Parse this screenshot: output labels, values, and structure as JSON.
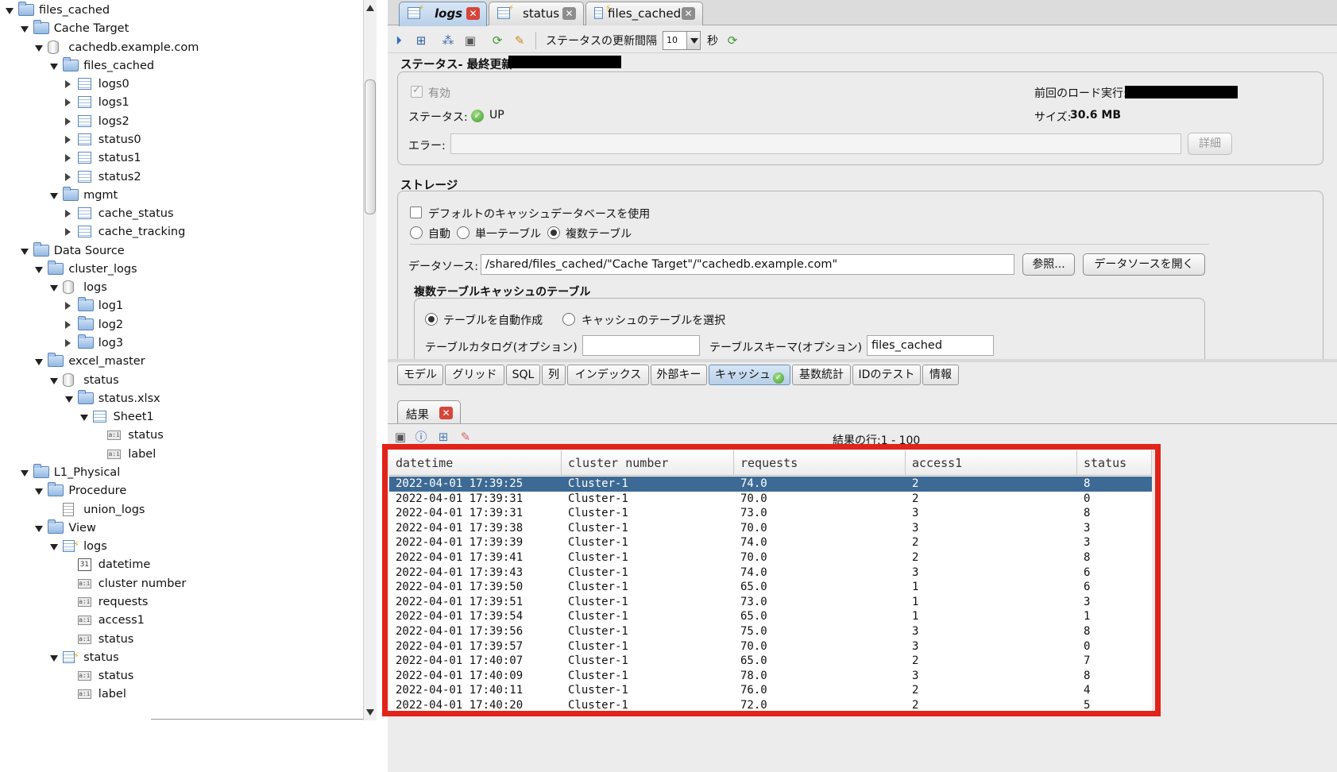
{
  "tree": {
    "nodes": [
      {
        "label": "files_cached",
        "depth": 0,
        "icon": "folder",
        "twisty": "open"
      },
      {
        "label": "Cache Target",
        "depth": 1,
        "icon": "folder",
        "twisty": "open"
      },
      {
        "label": "cachedb.example.com",
        "depth": 2,
        "icon": "database",
        "twisty": "open"
      },
      {
        "label": "files_cached",
        "depth": 3,
        "icon": "folder",
        "twisty": "open"
      },
      {
        "label": "logs0",
        "depth": 4,
        "icon": "table",
        "twisty": "closed"
      },
      {
        "label": "logs1",
        "depth": 4,
        "icon": "table",
        "twisty": "closed"
      },
      {
        "label": "logs2",
        "depth": 4,
        "icon": "table",
        "twisty": "closed"
      },
      {
        "label": "status0",
        "depth": 4,
        "icon": "table",
        "twisty": "closed"
      },
      {
        "label": "status1",
        "depth": 4,
        "icon": "table",
        "twisty": "closed"
      },
      {
        "label": "status2",
        "depth": 4,
        "icon": "table",
        "twisty": "closed"
      },
      {
        "label": "mgmt",
        "depth": 3,
        "icon": "folder",
        "twisty": "open"
      },
      {
        "label": "cache_status",
        "depth": 4,
        "icon": "table",
        "twisty": "closed"
      },
      {
        "label": "cache_tracking",
        "depth": 4,
        "icon": "table",
        "twisty": "closed"
      },
      {
        "label": "Data Source",
        "depth": 1,
        "icon": "folder",
        "twisty": "open"
      },
      {
        "label": "cluster_logs",
        "depth": 2,
        "icon": "folder",
        "twisty": "open"
      },
      {
        "label": "logs",
        "depth": 3,
        "icon": "database",
        "twisty": "open"
      },
      {
        "label": "log1",
        "depth": 4,
        "icon": "folder",
        "twisty": "closed"
      },
      {
        "label": "log2",
        "depth": 4,
        "icon": "folder",
        "twisty": "closed"
      },
      {
        "label": "log3",
        "depth": 4,
        "icon": "folder",
        "twisty": "closed"
      },
      {
        "label": "excel_master",
        "depth": 2,
        "icon": "folder",
        "twisty": "open"
      },
      {
        "label": "status",
        "depth": 3,
        "icon": "database",
        "twisty": "open"
      },
      {
        "label": "status.xlsx",
        "depth": 4,
        "icon": "folder",
        "twisty": "open"
      },
      {
        "label": "Sheet1",
        "depth": 5,
        "icon": "table",
        "twisty": "open"
      },
      {
        "label": "status",
        "depth": 6,
        "icon": "column",
        "twisty": "none"
      },
      {
        "label": "label",
        "depth": 6,
        "icon": "column",
        "twisty": "none"
      },
      {
        "label": "L1_Physical",
        "depth": 1,
        "icon": "folder",
        "twisty": "open"
      },
      {
        "label": "Procedure",
        "depth": 2,
        "icon": "folder",
        "twisty": "open"
      },
      {
        "label": "union_logs",
        "depth": 3,
        "icon": "document",
        "twisty": "none"
      },
      {
        "label": "View",
        "depth": 2,
        "icon": "folder",
        "twisty": "open"
      },
      {
        "label": "logs",
        "depth": 3,
        "icon": "view",
        "twisty": "open"
      },
      {
        "label": "datetime",
        "depth": 4,
        "icon": "date",
        "twisty": "none"
      },
      {
        "label": "cluster number",
        "depth": 4,
        "icon": "column",
        "twisty": "none"
      },
      {
        "label": "requests",
        "depth": 4,
        "icon": "column",
        "twisty": "none"
      },
      {
        "label": "access1",
        "depth": 4,
        "icon": "column",
        "twisty": "none"
      },
      {
        "label": "status",
        "depth": 4,
        "icon": "column",
        "twisty": "none"
      },
      {
        "label": "status",
        "depth": 3,
        "icon": "view",
        "twisty": "open"
      },
      {
        "label": "status",
        "depth": 4,
        "icon": "column",
        "twisty": "none"
      },
      {
        "label": "label",
        "depth": 4,
        "icon": "column",
        "twisty": "none"
      }
    ]
  },
  "tabs": [
    {
      "label": "logs",
      "active": true
    },
    {
      "label": "status",
      "active": false
    },
    {
      "label": "files_cached",
      "active": false
    }
  ],
  "toolbar": {
    "interval_label": "ステータスの更新間隔",
    "interval_value": "10",
    "interval_unit": "秒"
  },
  "status_section": {
    "title": "ステータス- 最終更新:",
    "enabled_label": "有効",
    "last_load_label": "前回のロード実行:",
    "status_label": "ステータス:",
    "status_value": "UP",
    "size_label": "サイズ:",
    "size_value": "30.6 MB",
    "error_label": "エラー:",
    "error_value": "",
    "detail_button": "詳細"
  },
  "storage_section": {
    "title": "ストレージ",
    "default_db_label": "デフォルトのキャッシュデータベースを使用",
    "mode_options": [
      "自動",
      "単一テーブル",
      "複数テーブル"
    ],
    "mode_selected": "複数テーブル",
    "datasource_label": "データソース:",
    "datasource_value": "/shared/files_cached/\"Cache Target\"/\"cachedb.example.com\"",
    "browse_button": "参照...",
    "open_datasource_button": "データソースを開く",
    "multi_table_title": "複数テーブルキャッシュのテーブル",
    "auto_create_label": "テーブルを自動作成",
    "select_table_label": "キャッシュのテーブルを選択",
    "catalog_label": "テーブルカタログ(オプション)",
    "catalog_value": "",
    "schema_label": "テーブルスキーマ(オプション)",
    "schema_value": "files_cached"
  },
  "subtabs": [
    {
      "label": "モデル",
      "active": false
    },
    {
      "label": "グリッド",
      "active": false
    },
    {
      "label": "SQL",
      "active": false
    },
    {
      "label": "列",
      "active": false
    },
    {
      "label": "インデックス",
      "active": false
    },
    {
      "label": "外部キー",
      "active": false
    },
    {
      "label": "キャッシュ",
      "active": true
    },
    {
      "label": "基数統計",
      "active": false
    },
    {
      "label": "IDのテスト",
      "active": false
    },
    {
      "label": "情報",
      "active": false
    }
  ],
  "results": {
    "tab_label": "結果",
    "row_count_label": "結果の行:1 - 100",
    "columns": [
      "datetime",
      "cluster number",
      "requests",
      "access1",
      "status"
    ],
    "rows": [
      [
        "2022-04-01 17:39:25",
        "Cluster-1",
        "74.0",
        "2",
        "8"
      ],
      [
        "2022-04-01 17:39:31",
        "Cluster-1",
        "70.0",
        "2",
        "0"
      ],
      [
        "2022-04-01 17:39:31",
        "Cluster-1",
        "73.0",
        "3",
        "8"
      ],
      [
        "2022-04-01 17:39:38",
        "Cluster-1",
        "70.0",
        "3",
        "3"
      ],
      [
        "2022-04-01 17:39:39",
        "Cluster-1",
        "74.0",
        "2",
        "3"
      ],
      [
        "2022-04-01 17:39:41",
        "Cluster-1",
        "70.0",
        "2",
        "8"
      ],
      [
        "2022-04-01 17:39:43",
        "Cluster-1",
        "74.0",
        "3",
        "6"
      ],
      [
        "2022-04-01 17:39:50",
        "Cluster-1",
        "65.0",
        "1",
        "6"
      ],
      [
        "2022-04-01 17:39:51",
        "Cluster-1",
        "73.0",
        "1",
        "3"
      ],
      [
        "2022-04-01 17:39:54",
        "Cluster-1",
        "65.0",
        "1",
        "1"
      ],
      [
        "2022-04-01 17:39:56",
        "Cluster-1",
        "75.0",
        "3",
        "8"
      ],
      [
        "2022-04-01 17:39:57",
        "Cluster-1",
        "70.0",
        "3",
        "0"
      ],
      [
        "2022-04-01 17:40:07",
        "Cluster-1",
        "65.0",
        "2",
        "7"
      ],
      [
        "2022-04-01 17:40:09",
        "Cluster-1",
        "78.0",
        "3",
        "8"
      ],
      [
        "2022-04-01 17:40:11",
        "Cluster-1",
        "76.0",
        "2",
        "4"
      ],
      [
        "2022-04-01 17:40:20",
        "Cluster-1",
        "72.0",
        "2",
        "5"
      ]
    ],
    "selected_row": 0
  }
}
